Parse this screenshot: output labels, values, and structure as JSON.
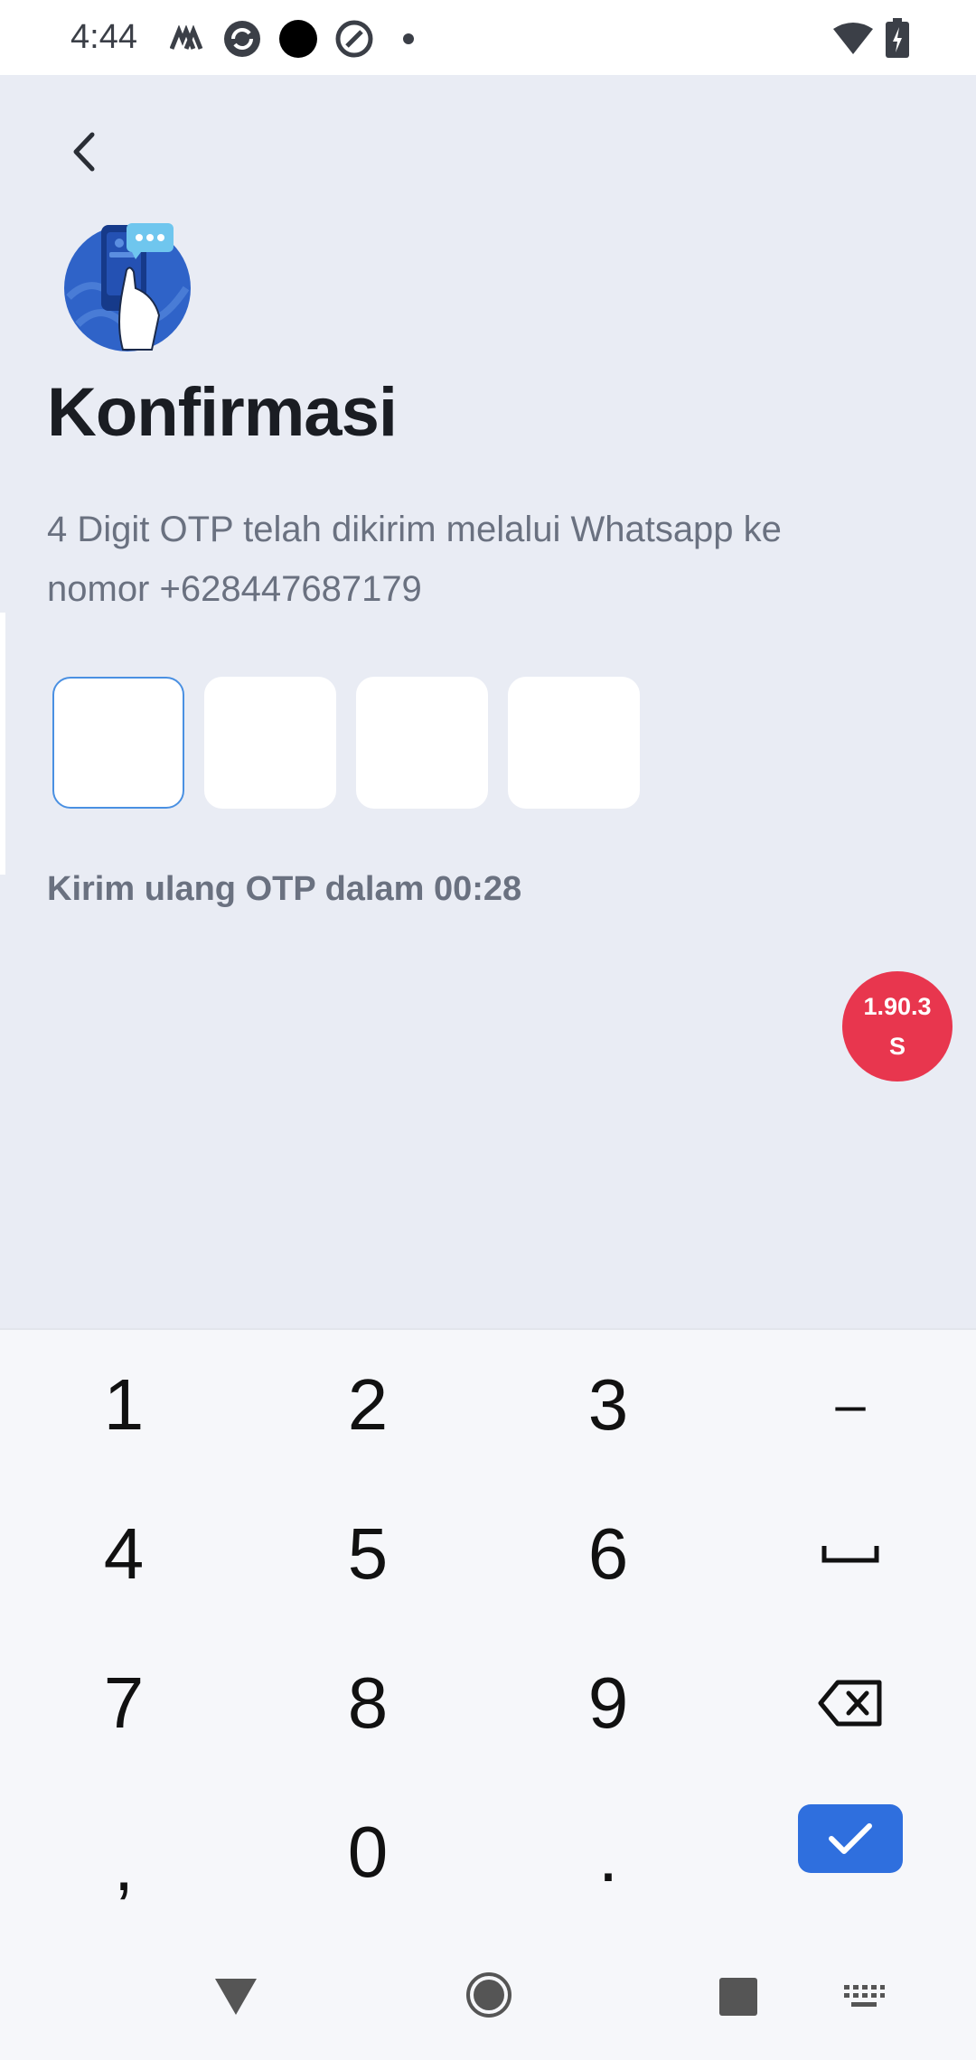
{
  "status_bar": {
    "time": "4:44"
  },
  "header": {
    "title": "Konfirmasi",
    "subtitle": "4 Digit OTP telah dikirim melalui Whatsapp ke nomor  +628447687179"
  },
  "otp": {
    "digits": [
      "",
      "",
      "",
      ""
    ]
  },
  "resend_text": "Kirim ulang OTP dalam 00:28",
  "version_badge": {
    "line1": "1.90.3",
    "line2": "S"
  },
  "keyboard": {
    "keys": [
      "1",
      "2",
      "3",
      "–",
      "4",
      "5",
      "6",
      "␣",
      "7",
      "8",
      "9",
      "backspace",
      ",",
      "0",
      ".",
      "done"
    ]
  },
  "colors": {
    "accent": "#2F6FDE",
    "badge": "#E8364E",
    "background": "#E9ECF4"
  },
  "icons": {
    "back": "chevron-left-icon",
    "hero": "phone-chat-hand-icon",
    "backspace": "backspace-icon",
    "done": "check-icon"
  }
}
